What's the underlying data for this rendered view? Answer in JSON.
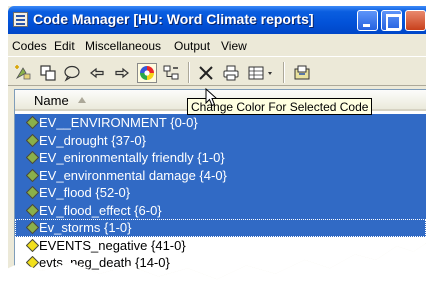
{
  "window": {
    "title": "Code Manager [HU: Word Climate reports]"
  },
  "menu": {
    "items": [
      "Codes",
      "Edit",
      "Miscellaneous",
      "Output",
      "View"
    ]
  },
  "toolbar": {
    "buttons": [
      "new-code-icon",
      "duplicate-icon",
      "comment-icon",
      "arrow-left-icon",
      "arrow-right-icon",
      "color-wheel-icon",
      "tree-icon",
      "delete-icon",
      "print-icon",
      "view-menu-icon",
      "export-icon"
    ],
    "tooltip": "Change Color For Selected Code"
  },
  "list": {
    "column_header": "Name",
    "rows": [
      {
        "label": "EV__ENVIRONMENT {0-0}",
        "selected": true,
        "icon_color": "#8ab04a"
      },
      {
        "label": "EV_drought {37-0}",
        "selected": true,
        "icon_color": "#8ab04a"
      },
      {
        "label": "EV_enironmentally friendly {1-0}",
        "selected": true,
        "icon_color": "#8ab04a"
      },
      {
        "label": "EV_environmental damage {4-0}",
        "selected": true,
        "icon_color": "#8ab04a"
      },
      {
        "label": "EV_flood {52-0}",
        "selected": true,
        "icon_color": "#8ab04a"
      },
      {
        "label": "EV_flood_effect {6-0}",
        "selected": true,
        "icon_color": "#8ab04a"
      },
      {
        "label": "Ev_storms {1-0}",
        "selected": true,
        "icon_color": "#8ab04a"
      },
      {
        "label": "EVENTS_negative {41-0}",
        "selected": false,
        "icon_color": "#f2e01c"
      },
      {
        "label": "evts_neg_death {14-0}",
        "selected": false,
        "icon_color": "#f2e01c"
      }
    ]
  },
  "colors": {
    "titlebar": "#0252d8",
    "selection": "#316ac5",
    "tooltip_bg": "#ffffe1"
  }
}
